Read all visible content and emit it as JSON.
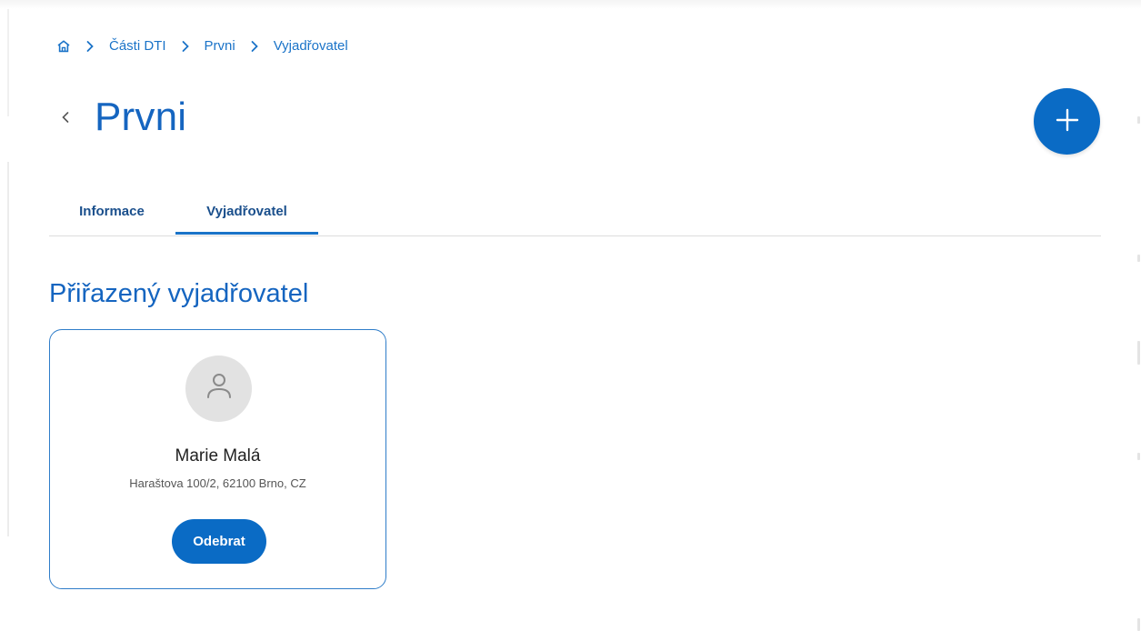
{
  "breadcrumb": {
    "home_icon": "home-icon",
    "items": [
      {
        "label": "Části DTI"
      },
      {
        "label": "Prvni"
      },
      {
        "label": "Vyjadřovatel"
      }
    ]
  },
  "header": {
    "title": "Prvni",
    "back_icon": "chevron-left-icon",
    "add_icon": "plus-icon"
  },
  "tabs": [
    {
      "label": "Informace",
      "active": false
    },
    {
      "label": "Vyjadřovatel",
      "active": true
    }
  ],
  "section": {
    "title": "Přiřazený vyjadřovatel"
  },
  "assignee_card": {
    "avatar_icon": "user-icon",
    "name": "Marie Malá",
    "address": "Haraštova 100/2, 62100 Brno, CZ",
    "remove_label": "Odebrat"
  },
  "colors": {
    "primary": "#0a6bc5",
    "title_blue": "#1565c0",
    "link_blue": "#1a73c8",
    "tab_text": "#1a4f8c",
    "card_border": "#2f7dc9",
    "avatar_bg": "#e2e2e2"
  }
}
